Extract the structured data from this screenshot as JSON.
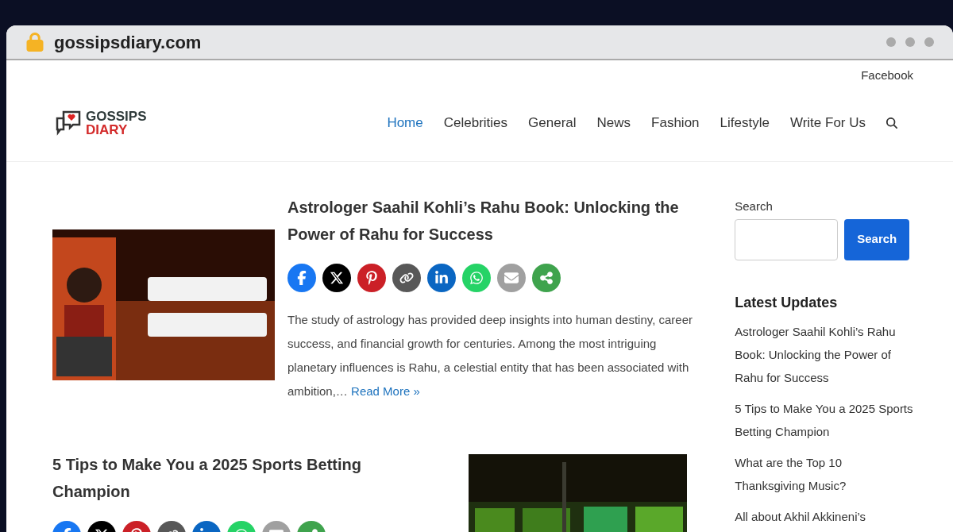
{
  "browser": {
    "url": "gossipsdiary.com"
  },
  "top_bar": {
    "link": "Facebook"
  },
  "logo": {
    "line1": "GOSSIPS",
    "line2": "DIARY"
  },
  "nav": [
    {
      "label": "Home",
      "selected": true
    },
    {
      "label": "Celebrities",
      "selected": false
    },
    {
      "label": "General",
      "selected": false
    },
    {
      "label": "News",
      "selected": false
    },
    {
      "label": "Fashion",
      "selected": false
    },
    {
      "label": "Lifestyle",
      "selected": false
    },
    {
      "label": "Write For Us",
      "selected": false
    }
  ],
  "posts": [
    {
      "title": "Astrologer Saahil Kohli’s Rahu Book: Unlocking the Power of Rahu for Success",
      "kind": "left",
      "excerpt": "The study of astrology has provided deep insights into human destiny, career success, and financial growth for centuries. Among the most intriguing planetary influences is Rahu, a celestial entity that has been associated with ambition,…",
      "read_more": "Read More »"
    },
    {
      "title": "5 Tips to Make You a 2025 Sports Betting Champion",
      "kind": "right"
    }
  ],
  "share_buttons": [
    {
      "kind": "facebook",
      "color": "#1877f2"
    },
    {
      "kind": "x",
      "color": "#000000"
    },
    {
      "kind": "pinterest",
      "color": "#cb2027"
    },
    {
      "kind": "link",
      "color": "#585858"
    },
    {
      "kind": "linkedin",
      "color": "#0a66c2"
    },
    {
      "kind": "whatsapp",
      "color": "#25d366"
    },
    {
      "kind": "email",
      "color": "#a0a0a0"
    },
    {
      "kind": "more",
      "color": "#3fa34d"
    }
  ],
  "sidebar": {
    "search_label": "Search",
    "search_button": "Search",
    "latest_title": "Latest Updates",
    "latest": [
      "Astrologer Saahil Kohli’s Rahu Book: Unlocking the Power of Rahu for Success",
      "5 Tips to Make You a 2025 Sports Betting Champion",
      "What are the Top 10 Thanksgiving Music?",
      "All about Akhil Akkineni’s"
    ]
  }
}
